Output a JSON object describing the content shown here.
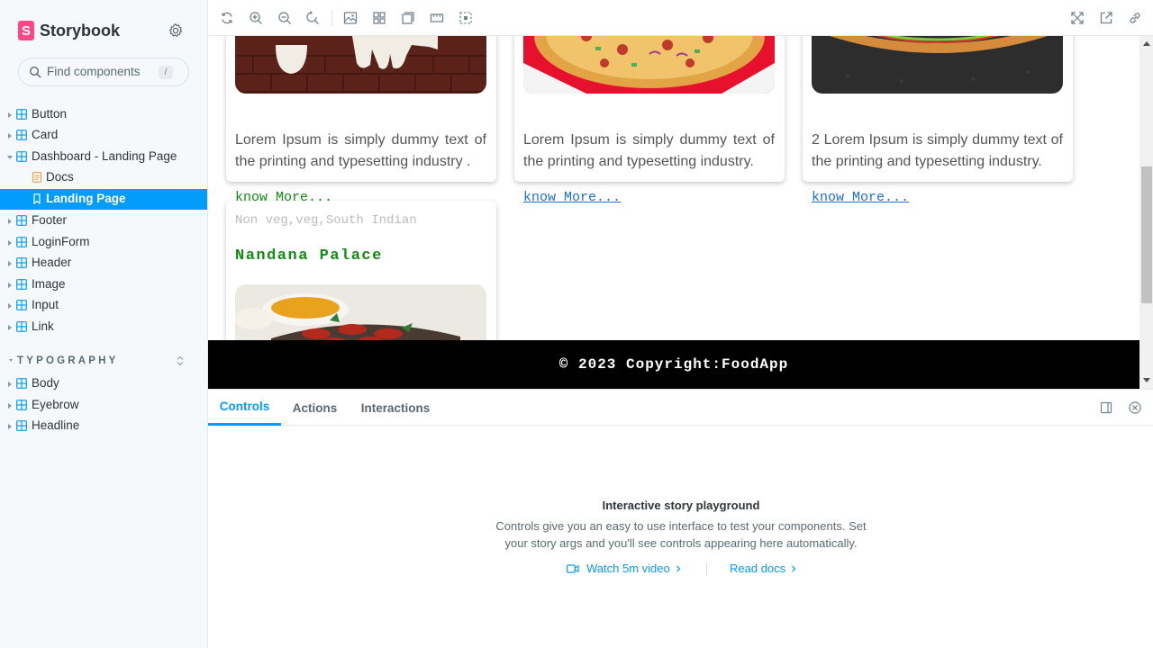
{
  "sidebar": {
    "brand": "Storybook",
    "search_placeholder": "Find components",
    "search_shortcut": "/",
    "items": [
      {
        "label": "Button"
      },
      {
        "label": "Card"
      },
      {
        "label": "Dashboard - Landing Page"
      },
      {
        "label": "Docs"
      },
      {
        "label": "Landing Page"
      },
      {
        "label": "Footer"
      },
      {
        "label": "LoginForm"
      },
      {
        "label": "Header"
      },
      {
        "label": "Image"
      },
      {
        "label": "Input"
      },
      {
        "label": "Link"
      }
    ],
    "section_title": "TYPOGRAPHY",
    "typography_items": [
      {
        "label": "Body"
      },
      {
        "label": "Eyebrow"
      },
      {
        "label": "Headline"
      }
    ]
  },
  "preview": {
    "cards": [
      {
        "text": "Lorem Ipsum is simply dummy text of the printing and typesetting industry .",
        "link": "know More...",
        "link_color": "#138a13"
      },
      {
        "text": "Lorem Ipsum is simply dummy text of the printing and typesetting industry.",
        "link": "know More...",
        "link_color": "#1a6fd8"
      },
      {
        "text": "2 Lorem Ipsum is simply dummy text of the printing and typesetting industry.",
        "link": "know More...",
        "link_color": "#1a6fd8"
      }
    ],
    "card4": {
      "tags": "Non veg,veg,South Indian",
      "name": "Nandana Palace"
    },
    "footer": "© 2023 Copyright:FoodApp"
  },
  "addons": {
    "tabs": [
      {
        "label": "Controls"
      },
      {
        "label": "Actions"
      },
      {
        "label": "Interactions"
      }
    ],
    "empty_title": "Interactive story playground",
    "empty_desc": "Controls give you an easy to use interface to test your components. Set your story args and you'll see controls appearing here automatically.",
    "watch_video": "Watch 5m video",
    "read_docs": "Read docs"
  },
  "colors": {
    "accent": "#029cfd",
    "brand": "#ff4785"
  }
}
